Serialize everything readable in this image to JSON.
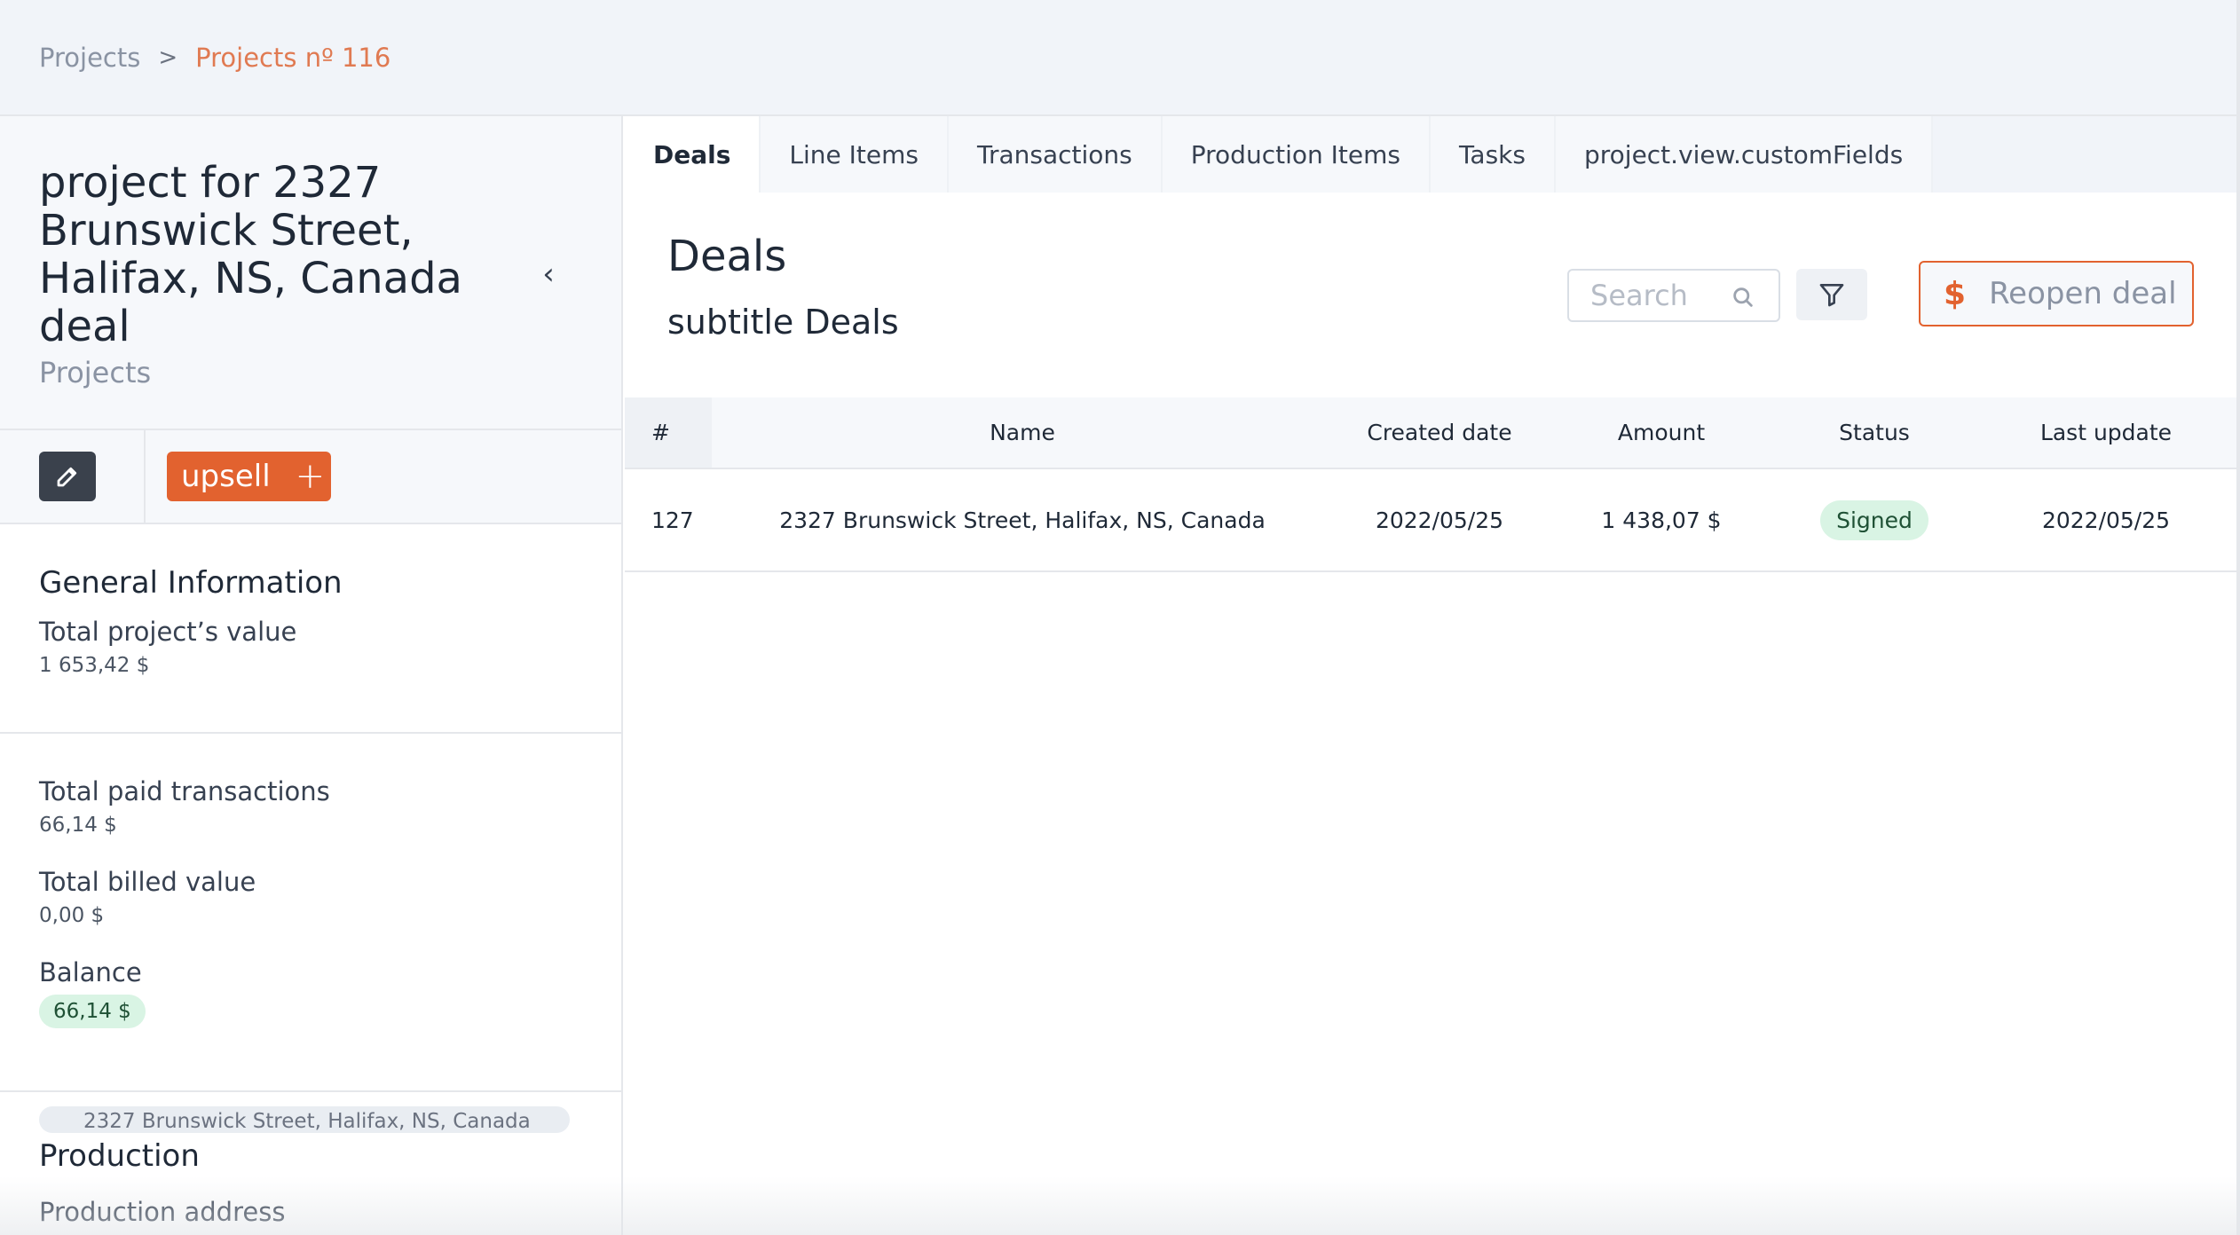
{
  "breadcrumb": {
    "root": "Projects",
    "separator": ">",
    "current": "Projects nº 116"
  },
  "project": {
    "title": "project for 2327 Brunswick Street, Halifax, NS, Canada deal",
    "subtitle": "Projects",
    "collapse_icon": "chevron-left-icon"
  },
  "actions": {
    "edit_icon": "pencil-icon",
    "upsell_label": "upsell",
    "upsell_icon": "plus-icon"
  },
  "general": {
    "title": "General Information",
    "total_value_label": "Total project’s value",
    "total_value": "1 653,42 $",
    "paid_label": "Total paid transactions",
    "paid_value": "66,14 $",
    "billed_label": "Total billed value",
    "billed_value": "0,00 $",
    "balance_label": "Balance",
    "balance_value": "66,14 $"
  },
  "production": {
    "title": "Production",
    "address_label": "Production address",
    "address_value": "2327 Brunswick Street, Halifax, NS, Canada"
  },
  "tabs": [
    {
      "label": "Deals",
      "active": true
    },
    {
      "label": "Line Items",
      "active": false
    },
    {
      "label": "Transactions",
      "active": false
    },
    {
      "label": "Production Items",
      "active": false
    },
    {
      "label": "Tasks",
      "active": false
    },
    {
      "label": "project.view.customFields",
      "active": false
    }
  ],
  "deals": {
    "title": "Deals",
    "subtitle": "subtitle Deals",
    "search_placeholder": "Search",
    "reopen_label": "Reopen deal",
    "columns": [
      "#",
      "Name",
      "Created date",
      "Amount",
      "Status",
      "Last update"
    ],
    "rows": [
      {
        "num": "127",
        "name": "2327 Brunswick Street, Halifax, NS, Canada",
        "created": "2022/05/25",
        "amount": "1 438,07 $",
        "status": "Signed",
        "updated": "2022/05/25"
      }
    ]
  },
  "colors": {
    "accent": "#e2622f",
    "breadcrumb_current": "#e07a52",
    "success_bg": "#d9f4e4",
    "success_text": "#1f5135"
  }
}
